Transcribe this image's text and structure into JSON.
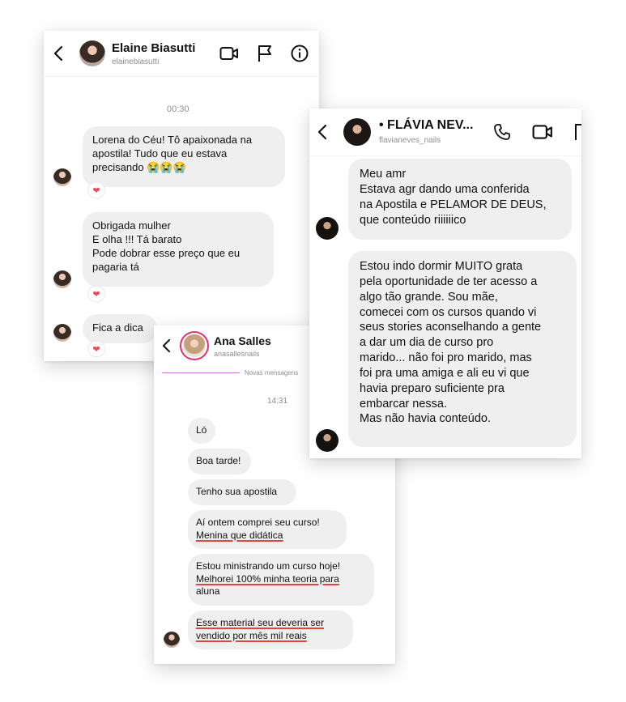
{
  "elaine": {
    "name": "Elaine Biasutti",
    "handle": "elainebiasutti",
    "timestamp": "00:30",
    "messages": [
      [
        "Lorena do Céu! Tô apaixonada na",
        "apostila! Tudo que eu estava",
        "precisando 😭😭😭"
      ],
      [
        "Obrigada mulher",
        "E olha !!! Tá barato",
        "Pode dobrar esse preço que eu",
        "pagaria tá"
      ],
      [
        "Fica a dica"
      ]
    ],
    "reaction": "❤"
  },
  "flavia": {
    "name": "• FLÁVIA NEV...",
    "handle": "flavianeves_nails",
    "messages": [
      [
        "Meu amr",
        "Estava agr dando uma conferida",
        "na Apostila e PELAMOR DE DEUS,",
        "que conteúdo riiiiiico"
      ],
      [
        "Estou indo dormir MUITO grata",
        "pela oportunidade de ter acesso a",
        "algo tão grande. Sou mãe,",
        "comecei com os cursos quando vi",
        "seus stories aconselhando a gente",
        "a dar um dia de curso pro",
        "marido... não foi pro marido, mas",
        "foi pra uma amiga e ali eu vi que",
        "havia preparo suficiente pra",
        "embarcar nessa.",
        "Mas não havia conteúdo."
      ]
    ]
  },
  "ana": {
    "name": "Ana Salles",
    "handle": "anasallesnails",
    "divider": "Novas mensagens",
    "timestamp": "14:31",
    "messages": [
      [
        "Ló"
      ],
      [
        "Boa tarde!"
      ],
      [
        "Tenho sua apostila"
      ],
      [
        "Aí ontem comprei seu curso!",
        "Menina que didática"
      ],
      [
        "Estou ministrando um curso hoje!",
        "Melhorei 100% minha teoria para",
        "aluna"
      ],
      [
        "Esse material seu deveria ser",
        "vendido por mês mil reais"
      ]
    ]
  },
  "icons": [
    "back-icon",
    "video-icon",
    "flag-icon",
    "info-icon",
    "phone-icon",
    "heart-icon"
  ]
}
